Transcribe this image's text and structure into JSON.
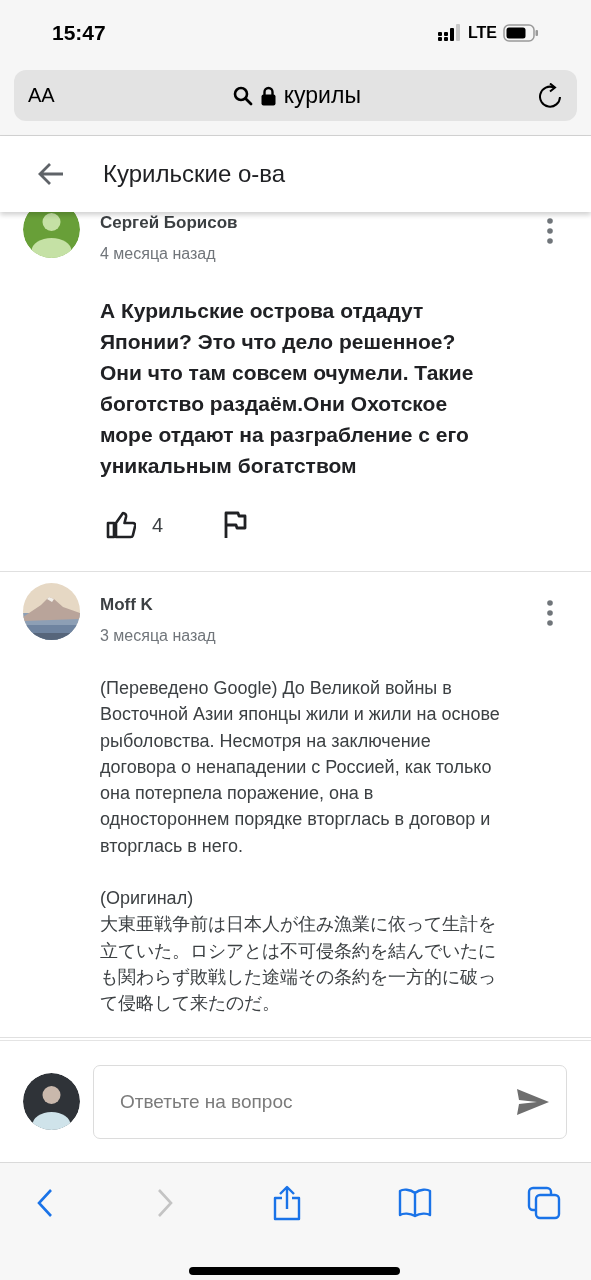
{
  "status_bar": {
    "time": "15:47",
    "network": "LTE"
  },
  "address_bar": {
    "text_size_button": "AA",
    "url": "курилы"
  },
  "header": {
    "title": "Курильские о-ва"
  },
  "comments": [
    {
      "author": "Сергей Борисов",
      "avatar": {
        "kind": "silhouette"
      },
      "time": "4 месяца назад",
      "bold": true,
      "text": "А Курильские острова отдадут Японии? Это что дело решенное? Они что там совсем очумели. Такие боготство раздаём.Они Охотское море отдают на разграбление с его уникальным богатством",
      "likes": "4"
    },
    {
      "author": "Moff K",
      "time": "3 месяца назад",
      "bold": false,
      "text": "(Переведено Google) До Великой войны в Восточной Азии японцы жили и жили на основе рыболовства. Несмотря на заключение договора о ненападении с Россией, как только она потерпела поражение, она в одностороннем порядке вторглась в договор и вторглась в него.",
      "original_label": "(Оригинал)",
      "original_text": "大東亜戦争前は日本人が住み漁業に依って生計を立ていた。ロシアとは不可侵条約を結んでいたにも関わらず敗戦した途端その条約を一方的に破って侵略して来たのだ。"
    }
  ],
  "reply": {
    "placeholder": "Ответьте на вопрос"
  },
  "toolbar": {
    "back_enabled": true,
    "forward_enabled": false
  }
}
